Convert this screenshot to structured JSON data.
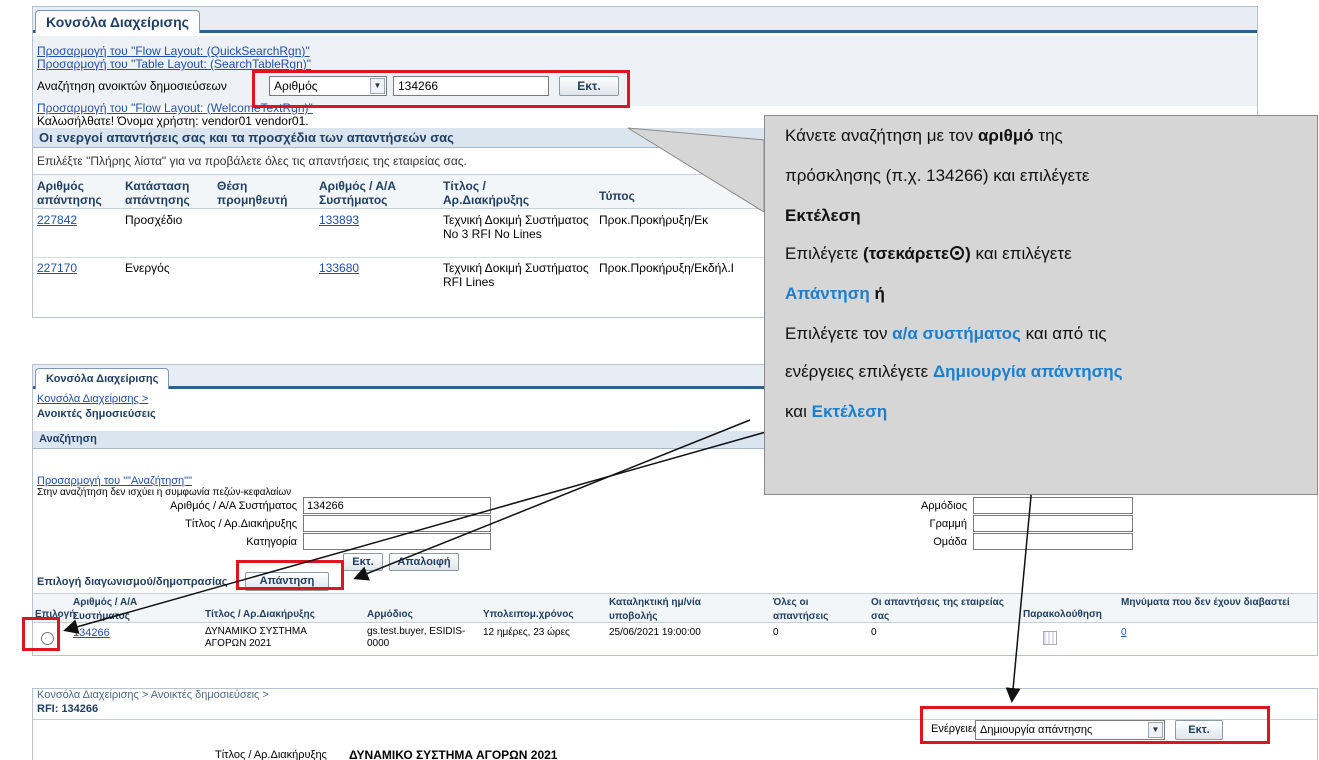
{
  "top": {
    "tab": "Κονσόλα Διαχείρισης",
    "link1": "Προσαρμογή του \"Flow Layout: (QuickSearchRgn)\"",
    "link2": "Προσαρμογή του \"Table Layout: (SearchTableRgn)\"",
    "search_label": "Αναζήτηση ανοικτών δημοσιεύσεων",
    "select_value": "Αριθμός",
    "search_value": "134266",
    "go": "Εκτ.",
    "link3": "Προσαρμογή του \"Flow Layout: (WelcomeTextRgn)\"",
    "welcome": "Καλωσήλθατε! Όνομα χρήστη: vendor01 vendor01.",
    "section": "Οι ενεργοί απαντήσεις σας και τα προσχέδια των απαντήσεών σας",
    "hint": "Επιλέξτε \"Πλήρης λίστα\" για να προβάλετε όλες τις απαντήσεις της εταιρείας σας.",
    "headers": [
      "Αριθμός απάντησης",
      "Κατάσταση απάντησης",
      "Θέση προμηθευτή",
      "Αριθμός / Α/Α Συστήματος",
      "Τίτλος / Αρ.Διακήρυξης",
      "Τύπος"
    ],
    "rows": [
      {
        "resp": "227842",
        "status": "Προσχέδιο",
        "sys": "133893",
        "title": "Τεχνική Δοκιμή Συστήματος No 3 RFI No Lines",
        "type": "Προκ.Προκήρυξη/Εκ"
      },
      {
        "resp": "227170",
        "status": "Ενεργός",
        "sys": "133680",
        "title": "Τεχνική Δοκιμή Συστήματος RFI Lines",
        "type": "Προκ.Προκήρυξη/Εκδήλ.I"
      }
    ]
  },
  "mid": {
    "tab": "Κονσόλα Διαχείρισης",
    "crumb": "Κονσόλα Διαχείρισης  >",
    "page": "Ανοικτές δημοσιεύσεις",
    "search_header": "Αναζήτηση",
    "custom": "Προσαρμογή του \"\"Αναζήτηση\"\"",
    "note": "Στην αναζήτηση δεν ισχύει η συμφωνία πεζών-κεφαλαίων",
    "f_sys_label": "Αριθμός / Α/Α Συστήματος",
    "f_sys": "134266",
    "f_title_label": "Τίτλος / Αρ.Διακήρυξης",
    "f_cat_label": "Κατηγορία",
    "f_buyer_label": "Αρμόδιος",
    "f_line_label": "Γραμμή",
    "f_group_label": "Ομάδα",
    "go": "Εκτ.",
    "clear": "Απαλοιφή",
    "select_label": "Επιλογή διαγωνισμού/δημοπρασίας",
    "answer": "Απάντηση",
    "headers": [
      "Επιλογή",
      "Αριθμός / Α/Α Συστήματος",
      "Τίτλος / Αρ.Διακήρυξης",
      "Αρμόδιος",
      "Υπολειπομ.χρόνος",
      "Καταληκτική ημ/νία υποβολής",
      "Όλες οι απαντήσεις",
      "Οι απαντήσεις της εταιρείας σας",
      "Παρακολούθηση",
      "Μηνύματα που δεν έχουν διαβαστεί"
    ],
    "row": {
      "sys": "134266",
      "title": "ΔΥΝΑΜΙΚΟ ΣΥΣΤΗΜΑ ΑΓΟΡΩΝ 2021",
      "buyer": "gs.test.buyer, ESIDIS-0000",
      "remaining": "12 ημέρες, 23 ώρες",
      "deadline": "25/06/2021 19:00:00",
      "all": "0",
      "company": "0",
      "unread": "0"
    }
  },
  "bottom": {
    "crumb": "Κονσόλα Διαχείρισης  >   Ανοικτές δημοσιεύσεις  >",
    "rfi": "RFI: 134266",
    "actions_label": "Ενέργειες",
    "actions_value": "Δημιουργία απάντησης",
    "go": "Εκτ.",
    "title_label": "Τίτλος / Αρ.Διακήρυξης",
    "title_value": "ΔΥΝΑΜΙΚΟ ΣΥΣΤΗΜΑ ΑΓΟΡΩΝ 2021"
  },
  "callout": {
    "l1a": "Κάνετε αναζήτηση με τον ",
    "l1b": "αριθμό",
    "l1c": " της",
    "l2": "πρόσκλησης (π.χ. 134266) και επιλέγετε",
    "l3": "Εκτέλεση",
    "l4a": "Επιλέγετε ",
    "l4b": "(τσεκάρετε",
    "l4c": ")",
    "l4d": " και επιλέγετε",
    "l5a": "Απάντηση",
    "l5b": " ή",
    "l6a": "Επιλέγετε τον ",
    "l6b": "α/α συστήματος",
    "l6c": " και από τις",
    "l7a": "ενέργειες επιλέγετε ",
    "l7b": "Δημιουργία απάντησης",
    "l8a": "και ",
    "l8b": "Εκτέλεση"
  }
}
